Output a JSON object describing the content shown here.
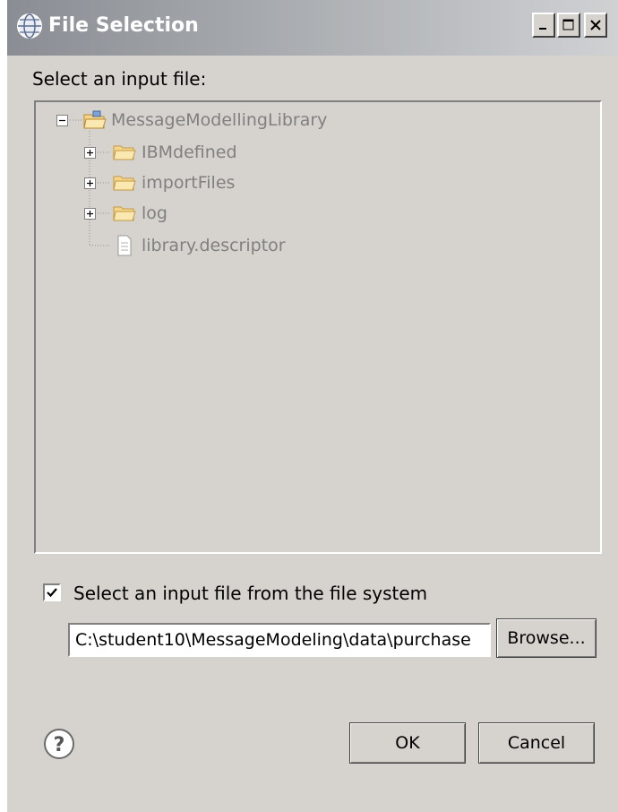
{
  "window": {
    "title": "File Selection",
    "icon": "globe-icon",
    "controls": [
      "minimize-icon",
      "maximize-icon",
      "close-icon"
    ]
  },
  "prompt": "Select an input file:",
  "tree": {
    "root": {
      "label": "MessageModellingLibrary",
      "icon": "project-folder-icon",
      "expanded": true
    },
    "children": [
      {
        "label": "IBMdefined",
        "icon": "folder-icon",
        "expandable": true
      },
      {
        "label": "importFiles",
        "icon": "folder-icon",
        "expandable": true
      },
      {
        "label": "log",
        "icon": "folder-icon",
        "expandable": true
      },
      {
        "label": "library.descriptor",
        "icon": "file-icon",
        "expandable": false
      }
    ]
  },
  "file_system": {
    "checkbox_label": "Select an input file from the file system",
    "checked": true,
    "path_value": "C:\\student10\\MessageModeling\\data\\purchase",
    "browse_label": "Browse..."
  },
  "buttons": {
    "ok": "OK",
    "cancel": "Cancel",
    "help_icon": "help-icon"
  }
}
